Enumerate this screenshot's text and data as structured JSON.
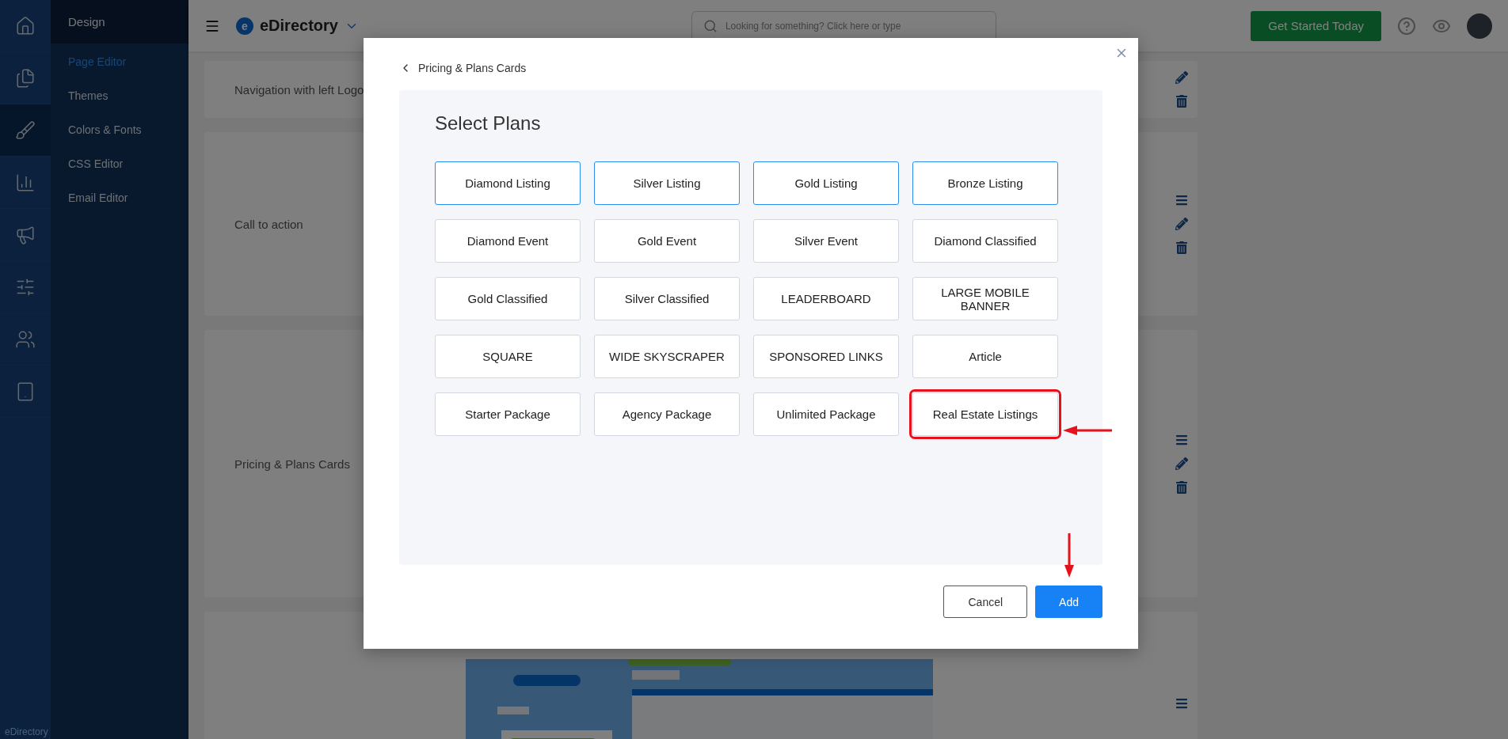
{
  "rail": [
    {
      "selected": false
    },
    {
      "selected": false
    },
    {
      "selected": true
    },
    {
      "selected": false
    },
    {
      "selected": false
    },
    {
      "selected": false
    },
    {
      "selected": false
    },
    {
      "selected": false
    }
  ],
  "rail_footer": "eDirectory",
  "submenu": {
    "title": "Design",
    "items": [
      {
        "label": "Page Editor",
        "selected": true
      },
      {
        "label": "Themes",
        "selected": false
      },
      {
        "label": "Colors & Fonts",
        "selected": false
      },
      {
        "label": "CSS Editor",
        "selected": false
      },
      {
        "label": "Email Editor",
        "selected": false
      }
    ]
  },
  "topbar": {
    "logo_mark": "e",
    "logo_text": "eDirectory",
    "search": {
      "placeholder": "Looking for something? Click here or type"
    },
    "cta": "Get Started Today"
  },
  "sections": [
    {
      "title": "Navigation with left Logo"
    },
    {
      "title": "Call to action"
    },
    {
      "title": "Pricing & Plans Cards"
    },
    {
      "kind": "picture"
    }
  ],
  "modal": {
    "back": "Pricing & Plans Cards",
    "title": "Select Plans",
    "plans": [
      {
        "label": "Diamond Listing",
        "selected": true,
        "highlighted": false
      },
      {
        "label": "Silver Listing",
        "selected": true,
        "highlighted": false
      },
      {
        "label": "Gold Listing",
        "selected": true,
        "highlighted": false
      },
      {
        "label": "Bronze Listing",
        "selected": true,
        "highlighted": false
      },
      {
        "label": "Diamond Event",
        "selected": false,
        "highlighted": false
      },
      {
        "label": "Gold Event",
        "selected": false,
        "highlighted": false
      },
      {
        "label": "Silver Event",
        "selected": false,
        "highlighted": false
      },
      {
        "label": "Diamond Classified",
        "selected": false,
        "highlighted": false
      },
      {
        "label": "Gold Classified",
        "selected": false,
        "highlighted": false
      },
      {
        "label": "Silver Classified",
        "selected": false,
        "highlighted": false
      },
      {
        "label": "LEADERBOARD",
        "selected": false,
        "highlighted": false
      },
      {
        "label": "LARGE MOBILE BANNER",
        "selected": false,
        "highlighted": false
      },
      {
        "label": "SQUARE",
        "selected": false,
        "highlighted": false
      },
      {
        "label": "WIDE SKYSCRAPER",
        "selected": false,
        "highlighted": false
      },
      {
        "label": "SPONSORED LINKS",
        "selected": false,
        "highlighted": false
      },
      {
        "label": "Article",
        "selected": false,
        "highlighted": false
      },
      {
        "label": "Starter Package",
        "selected": false,
        "highlighted": false
      },
      {
        "label": "Agency Package",
        "selected": false,
        "highlighted": false
      },
      {
        "label": "Unlimited Package",
        "selected": false,
        "highlighted": false
      },
      {
        "label": "Real Estate Listings",
        "selected": false,
        "highlighted": true
      }
    ],
    "buttons": [
      {
        "label": "Cancel",
        "kind": "secondary"
      },
      {
        "label": "Add",
        "kind": "primary",
        "highlighted": true
      }
    ]
  }
}
